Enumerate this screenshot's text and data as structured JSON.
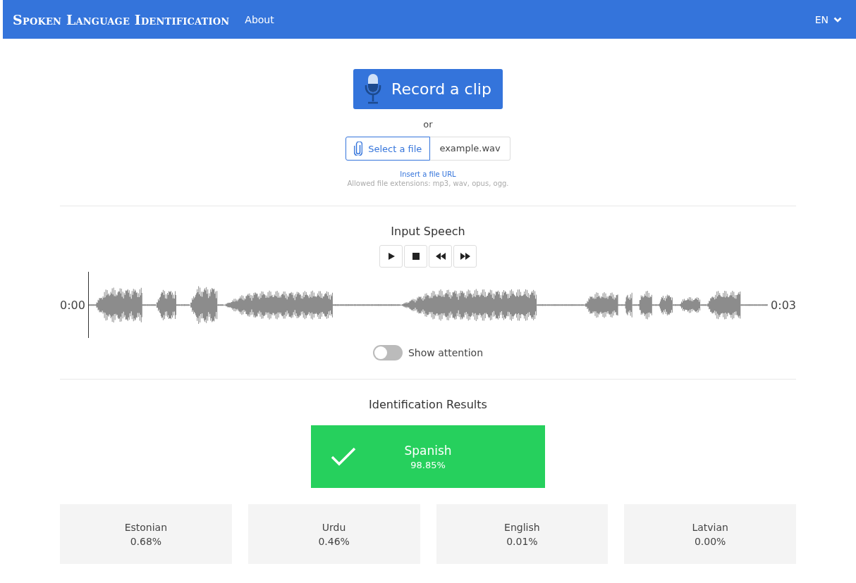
{
  "navbar": {
    "brand": "Spoken Language Identification",
    "links": [
      "About"
    ],
    "language": "EN"
  },
  "input": {
    "record_button": "Record a clip",
    "separator": "or",
    "file_button": "Select a file",
    "file_name": "example.wav",
    "url_link": "Insert a file URL",
    "hint": "Allowed file extensions: mp3, wav, opus, ogg."
  },
  "player": {
    "title": "Input Speech",
    "controls": [
      {
        "kind": "play"
      },
      {
        "kind": "stop"
      },
      {
        "kind": "rewind"
      },
      {
        "kind": "forward"
      }
    ],
    "start_time": "0:00",
    "end_time": "0:03",
    "attention_toggle": {
      "label": "Show attention",
      "on": false
    }
  },
  "results": {
    "title": "Identification Results",
    "top": {
      "language": "Spanish",
      "score": "98.85%"
    },
    "others": [
      {
        "language": "Estonian",
        "score": "0.68%"
      },
      {
        "language": "Urdu",
        "score": "0.46%"
      },
      {
        "language": "English",
        "score": "0.01%"
      },
      {
        "language": "Latvian",
        "score": "0.00%"
      }
    ]
  }
}
